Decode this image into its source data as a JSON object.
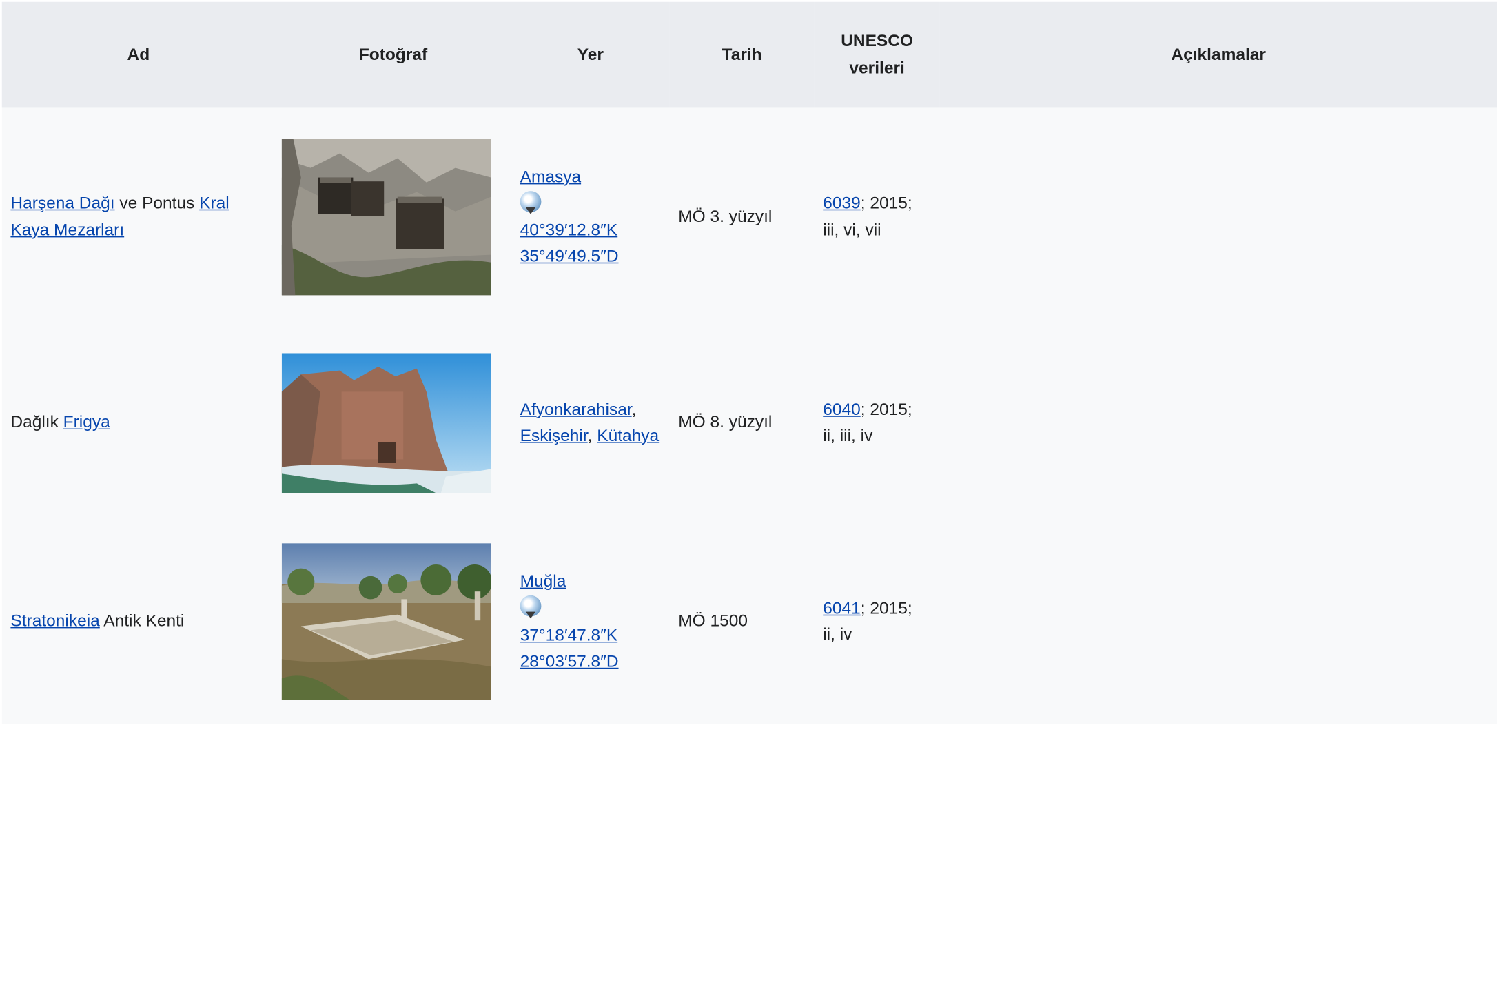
{
  "table": {
    "headers": {
      "name": "Ad",
      "photo": "Fotoğraf",
      "location": "Yer",
      "date": "Tarih",
      "unesco_line1": "UNESCO",
      "unesco_line2": "verileri",
      "notes": "Açıklamalar"
    },
    "rows": [
      {
        "name_link1": "Harşena Dağı",
        "name_text": " ve Pontus ",
        "name_link2": "Kral Kaya Mezarları",
        "location_link": "Amasya",
        "coord_icon": "globe-icon",
        "coordinates": "40°39′12.8″K 35°49′49.5″D",
        "date": "MÖ 3. yüzyıl",
        "unesco_id": "6039",
        "unesco_year": "; 2015;",
        "unesco_criteria": "iii, vi, vii",
        "photo_desc_colors": [
          "#7d7a74",
          "#a8a49b",
          "#4f5a3a"
        ]
      },
      {
        "name_text": "Dağlık ",
        "name_link": "Frigya",
        "location_link1": "Afyonkarahisar",
        "location_link2": "Eskişehir",
        "location_link3": "Kütahya",
        "date": "MÖ 8. yüzyıl",
        "unesco_id": "6040",
        "unesco_year": "; 2015;",
        "unesco_criteria": "ii, iii, iv"
      },
      {
        "name_link": "Stratonikeia",
        "name_text": " Antik Kenti",
        "location_link": "Muğla",
        "coord_icon": "globe-icon",
        "coordinates": "37°18′47.8″K 28°03′57.8″D",
        "date": "MÖ 1500",
        "unesco_id": "6041",
        "unesco_year": "; 2015;",
        "unesco_criteria": "ii, iv"
      }
    ]
  }
}
